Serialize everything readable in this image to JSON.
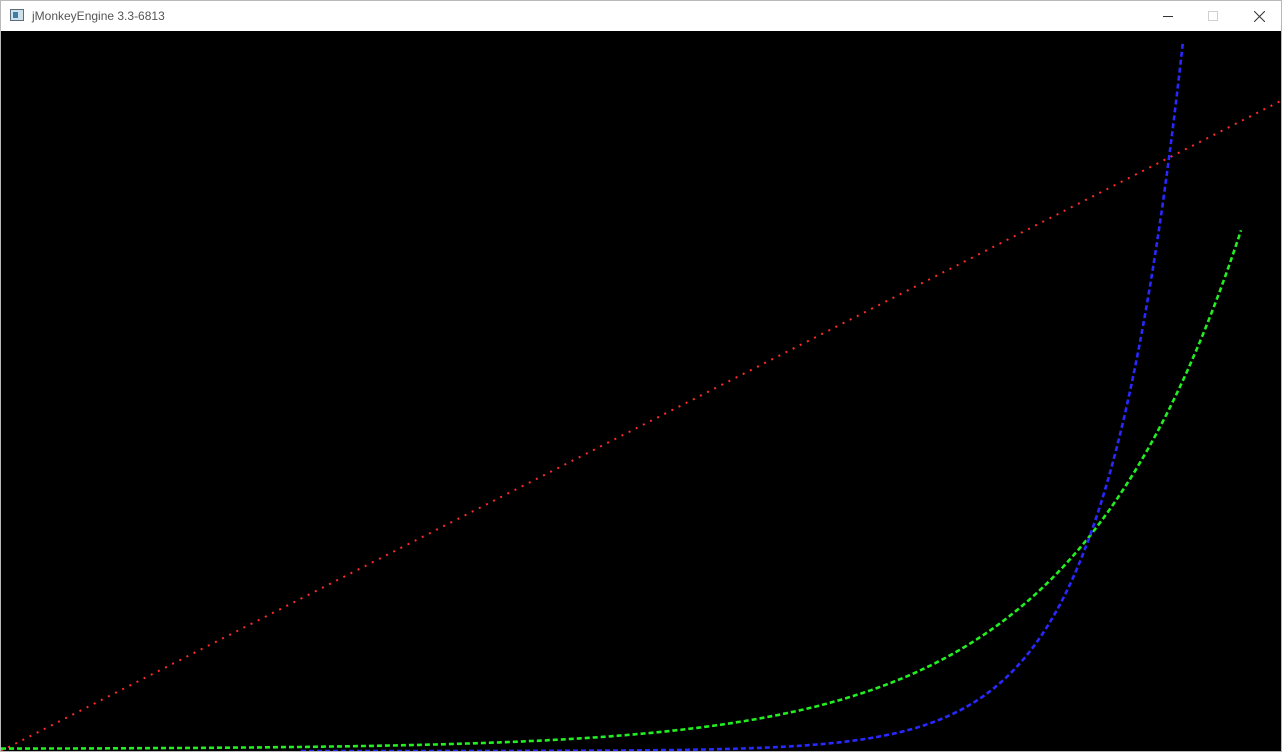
{
  "window": {
    "title": "jMonkeyEngine 3.3-6813",
    "icon": "app-window-icon",
    "controls": {
      "minimize_icon": "minimize-icon",
      "maximize_icon": "maximize-icon",
      "close_icon": "close-icon"
    }
  },
  "scene": {
    "background_color": "#000000",
    "curves": [
      {
        "color": "#ff2a2a",
        "style": "dotted",
        "shape": "straight line"
      },
      {
        "color": "#22ee22",
        "style": "dashed",
        "shape": "rising curve"
      },
      {
        "color": "#2828ff",
        "style": "dashed",
        "shape": "steeply rising curve"
      }
    ]
  }
}
